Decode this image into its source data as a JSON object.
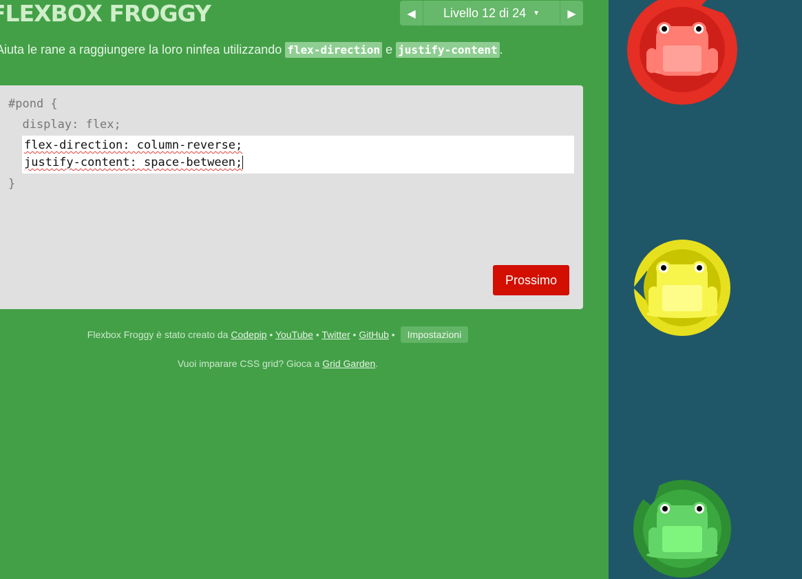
{
  "header": {
    "title": "FLEXBOX FROGGY",
    "level_label": "Livello 12 di 24",
    "prev_icon": "left-triangle-icon",
    "next_icon": "right-triangle-icon"
  },
  "instructions": {
    "text": "Aiuta le rane a raggiungere la loro ninfea utilizzando ",
    "code1": "flex-direction",
    "conj": " e ",
    "code2": "justify-content",
    "end": "."
  },
  "editor": {
    "line1": "#pond {",
    "line2": "  display: flex;",
    "input_line1": "flex-direction: column-reverse;",
    "input_line2": "justify-content: space-between;",
    "line_end": "}",
    "next_button": "Prossimo"
  },
  "footer": {
    "credits_prefix": "Flexbox Froggy è stato creato da ",
    "codepip": "Codepip",
    "youtube": "YouTube",
    "twitter": "Twitter",
    "github": "GitHub",
    "settings": "Impostazioni",
    "grid_prefix": "Vuoi imparare CSS grid? Gioca a ",
    "grid_link": "Grid Garden",
    "grid_end": "."
  },
  "pond": {
    "frogs": [
      {
        "color": "red",
        "name": "red-frog"
      },
      {
        "color": "yellow",
        "name": "yellow-frog"
      },
      {
        "color": "green",
        "name": "green-frog"
      }
    ]
  }
}
